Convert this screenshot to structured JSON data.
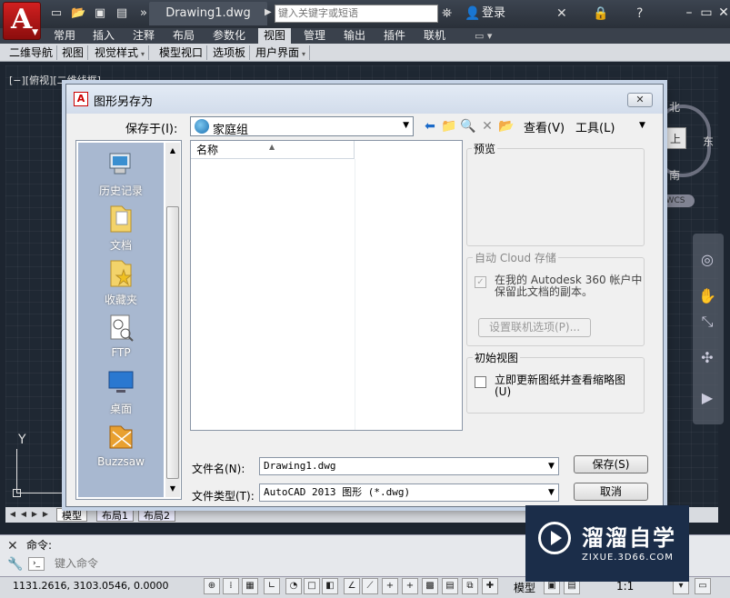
{
  "titlebar": {
    "doc_title": "Drawing1.dwg",
    "search_placeholder": "键入关键字或短语",
    "login": "登录"
  },
  "ribbon": {
    "tabs": [
      "常用",
      "插入",
      "注释",
      "布局",
      "参数化",
      "视图",
      "管理",
      "输出",
      "插件",
      "联机"
    ],
    "active_tab": "视图",
    "panels": [
      "二维导航",
      "视图",
      "视觉样式",
      "模型视口",
      "选项板",
      "用户界面"
    ]
  },
  "viewport": {
    "label": "[−][俯视][二维线框]",
    "compass": {
      "north": "北",
      "south": "南",
      "east": "东"
    },
    "cube_face": "上",
    "wcs": "WCS",
    "ucs_y": "Y"
  },
  "layout_tabs": [
    "模型",
    "布局1",
    "布局2"
  ],
  "command": {
    "history": "命令:",
    "placeholder": "键入命令"
  },
  "statusbar": {
    "coords": "1131.2616, 3103.0546, 0.0000",
    "model": "模型",
    "scale": "1:1"
  },
  "dialog": {
    "title": "图形另存为",
    "save_in_label": "保存于(I):",
    "save_in_value": "家庭组",
    "view_menu": "查看(V)",
    "tools_menu": "工具(L)",
    "places": [
      {
        "label": "历史记录",
        "icon": "history-icon"
      },
      {
        "label": "文档",
        "icon": "documents-icon"
      },
      {
        "label": "收藏夹",
        "icon": "favorites-icon"
      },
      {
        "label": "FTP",
        "icon": "ftp-icon"
      },
      {
        "label": "桌面",
        "icon": "desktop-icon"
      },
      {
        "label": "Buzzsaw",
        "icon": "buzzsaw-icon"
      }
    ],
    "column_name": "名称",
    "preview_label": "预览",
    "cloud_title": "自动 Cloud 存储",
    "cloud_text": "在我的 Autodesk 360 帐户中保留此文档的副本。",
    "cloud_button": "设置联机选项(P)...",
    "initial_view_title": "初始视图",
    "initial_view_text": "立即更新图纸并查看缩略图(U)",
    "filename_label": "文件名(N):",
    "filename_value": "Drawing1.dwg",
    "filetype_label": "文件类型(T):",
    "filetype_value": "AutoCAD 2013 图形 (*.dwg)",
    "save_button": "保存(S)",
    "cancel_button": "取消"
  },
  "watermark": {
    "title": "溜溜自学",
    "subtitle": "ZIXUE.3D66.COM"
  }
}
